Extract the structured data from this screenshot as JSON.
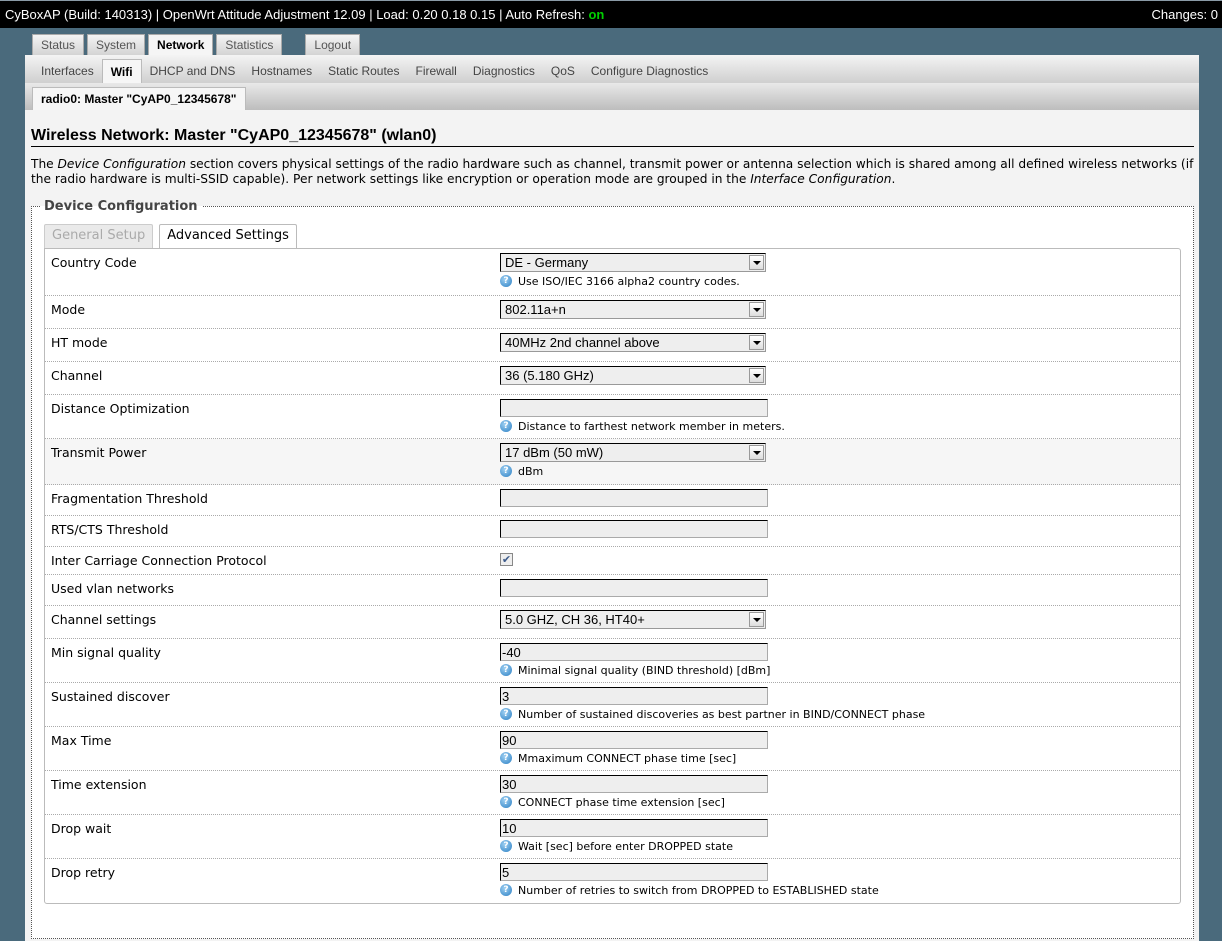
{
  "topbar": {
    "status_text": "CyBoxAP (Build: 140313) | OpenWrt Attitude Adjustment 12.09 | Load: 0.20 0.18 0.15 | Auto Refresh: ",
    "auto_refresh": "on",
    "changes": "Changes: 0"
  },
  "main_tabs": [
    {
      "label": "Status"
    },
    {
      "label": "System"
    },
    {
      "label": "Network",
      "active": true
    },
    {
      "label": "Statistics"
    },
    {
      "label": "Logout"
    }
  ],
  "sub_tabs": [
    {
      "label": "Interfaces"
    },
    {
      "label": "Wifi",
      "active": true
    },
    {
      "label": "DHCP and DNS"
    },
    {
      "label": "Hostnames"
    },
    {
      "label": "Static Routes"
    },
    {
      "label": "Firewall"
    },
    {
      "label": "Diagnostics"
    },
    {
      "label": "QoS"
    },
    {
      "label": "Configure Diagnostics"
    }
  ],
  "radio_tab": "radio0: Master \"CyAP0_12345678\"",
  "page_title": "Wireless Network: Master \"CyAP0_12345678\" (wlan0)",
  "description": {
    "p1": "The ",
    "em1": "Device Configuration",
    "p2": " section covers physical settings of the radio hardware such as channel, transmit power or antenna selection which is shared among all defined wireless networks (if the radio hardware is multi-SSID capable). Per network settings like encryption or operation mode are grouped in the ",
    "em2": "Interface Configuration",
    "p3": "."
  },
  "fieldset_legend": "Device Configuration",
  "inner_tabs": [
    {
      "label": "General Setup",
      "disabled": true
    },
    {
      "label": "Advanced Settings",
      "active": true
    }
  ],
  "settings": [
    {
      "label": "Country Code",
      "type": "select",
      "value": "DE - Germany",
      "hint": "Use ISO/IEC 3166 alpha2 country codes."
    },
    {
      "label": "Mode",
      "type": "select",
      "value": "802.11a+n"
    },
    {
      "label": "HT mode",
      "type": "select",
      "value": "40MHz 2nd channel above"
    },
    {
      "label": "Channel",
      "type": "select",
      "value": "36 (5.180 GHz)"
    },
    {
      "label": "Distance Optimization",
      "type": "text",
      "value": "",
      "hint": "Distance to farthest network member in meters."
    },
    {
      "label": "Transmit Power",
      "type": "select",
      "value": "17 dBm (50 mW)",
      "hint": "dBm",
      "shaded": true
    },
    {
      "label": "Fragmentation Threshold",
      "type": "text",
      "value": ""
    },
    {
      "label": "RTS/CTS Threshold",
      "type": "text",
      "value": ""
    },
    {
      "label": "Inter Carriage Connection Protocol",
      "type": "checkbox",
      "checked": true
    },
    {
      "label": "Used vlan networks",
      "type": "text",
      "value": ""
    },
    {
      "label": "Channel settings",
      "type": "select",
      "value": "5.0 GHZ, CH 36, HT40+"
    },
    {
      "label": "Min signal quality",
      "type": "text",
      "value": "-40",
      "hint": "Minimal signal quality (BIND threshold) [dBm]"
    },
    {
      "label": "Sustained discover",
      "type": "text",
      "value": "3",
      "hint": "Number of sustained discoveries as best partner in BIND/CONNECT phase"
    },
    {
      "label": "Max Time",
      "type": "text",
      "value": "90",
      "hint": "Mmaximum CONNECT phase time [sec]"
    },
    {
      "label": "Time extension",
      "type": "text",
      "value": "30",
      "hint": "CONNECT phase time extension [sec]"
    },
    {
      "label": "Drop wait",
      "type": "text",
      "value": "10",
      "hint": "Wait [sec] before enter DROPPED state"
    },
    {
      "label": "Drop retry",
      "type": "text",
      "value": "5",
      "hint": "Number of retries to switch from DROPPED to ESTABLISHED state"
    }
  ],
  "icons": {
    "help": "help-circle-icon",
    "dropdown": "chevron-down-icon",
    "check": "checkmark-icon"
  },
  "colors": {
    "topbar_bg": "#000000",
    "auto_refresh_on": "#00d000",
    "page_bg": "#4a6a7c",
    "help_icon": "#2a7fc4"
  }
}
